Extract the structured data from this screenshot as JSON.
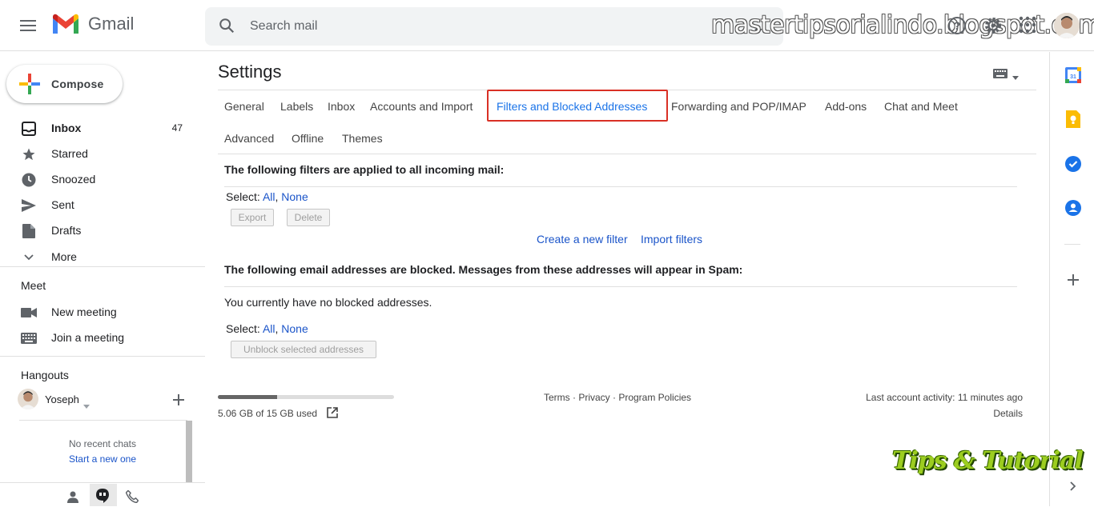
{
  "app": {
    "name": "Gmail"
  },
  "search": {
    "placeholder": "Search mail"
  },
  "watermark": "mastertipsorialindo.blogspot.com",
  "sidebar": {
    "compose_label": "Compose",
    "items": [
      {
        "label": "Inbox",
        "count": "47",
        "icon": "inbox-icon"
      },
      {
        "label": "Starred",
        "icon": "star-icon"
      },
      {
        "label": "Snoozed",
        "icon": "clock-icon"
      },
      {
        "label": "Sent",
        "icon": "send-icon"
      },
      {
        "label": "Drafts",
        "icon": "draft-icon"
      },
      {
        "label": "More",
        "icon": "chevron-down-icon"
      }
    ],
    "meet": {
      "title": "Meet",
      "items": [
        {
          "label": "New meeting",
          "icon": "videocam-icon"
        },
        {
          "label": "Join a meeting",
          "icon": "keyboard-icon"
        }
      ]
    },
    "hangouts": {
      "title": "Hangouts",
      "user": "Yoseph",
      "no_chats": "No recent chats",
      "start_new": "Start a new one"
    }
  },
  "settings": {
    "title": "Settings",
    "tabs": [
      "General",
      "Labels",
      "Inbox",
      "Accounts and Import",
      "Filters and Blocked Addresses",
      "Forwarding and POP/IMAP",
      "Add-ons",
      "Chat and Meet",
      "Advanced",
      "Offline",
      "Themes"
    ],
    "active_tab": "Filters and Blocked Addresses",
    "filters_heading": "The following filters are applied to all incoming mail:",
    "select_label": "Select:",
    "select_all": "All",
    "select_comma": ",",
    "select_none": "None",
    "export_btn": "Export",
    "delete_btn": "Delete",
    "create_filter": "Create a new filter",
    "import_filters": "Import filters",
    "blocked_heading": "The following email addresses are blocked. Messages from these addresses will appear in Spam:",
    "no_blocked": "You currently have no blocked addresses.",
    "unblock_btn": "Unblock selected addresses"
  },
  "footer": {
    "storage_text": "5.06 GB of 15 GB used",
    "storage_fraction": 0.337,
    "links": "Terms · Privacy · Program Policies",
    "last_activity": "Last account activity: 11 minutes ago",
    "details": "Details"
  },
  "overlay_logo": "Tips & Tutorial",
  "colors": {
    "accent": "#1a73e8",
    "highlight_box": "#d93025",
    "link": "#1a54c9"
  }
}
